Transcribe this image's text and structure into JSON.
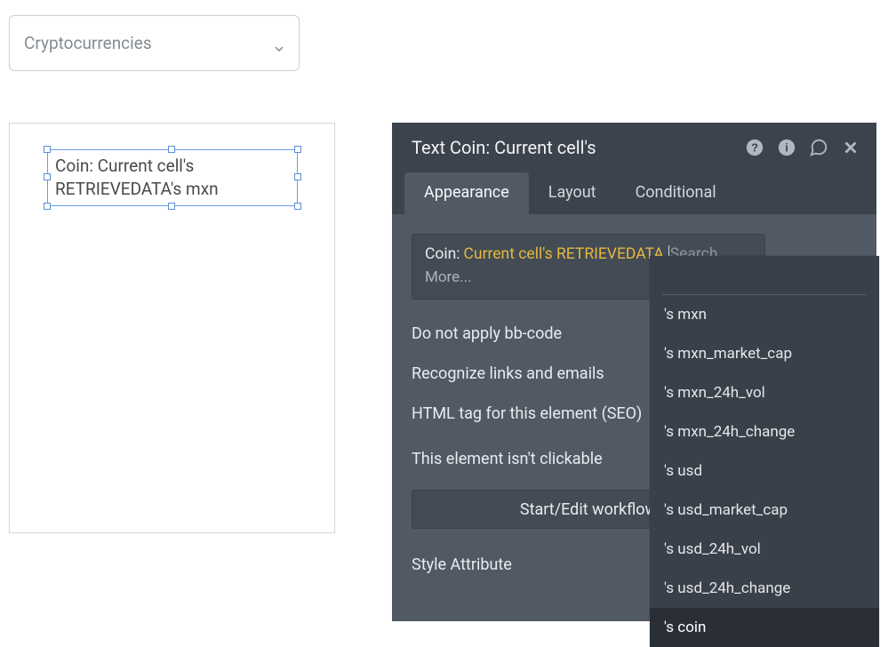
{
  "dropdown": {
    "value": "Cryptocurrencies"
  },
  "canvas": {
    "selected_text": "Coin: Current cell's RETRIEVEDATA's mxn"
  },
  "panel": {
    "title": "Text Coin: Current cell's",
    "tabs": {
      "appearance": "Appearance",
      "layout": "Layout",
      "conditional": "Conditional"
    },
    "expression": {
      "static": "Coin:",
      "dynamic": "Current cell's RETRIEVEDATA",
      "search_placeholder": "Search...",
      "more": "More..."
    },
    "options": {
      "bbcode": "Do not apply bb-code",
      "recognize": "Recognize links and emails",
      "html_tag": "HTML tag for this element (SEO)",
      "not_clickable": "This element isn't clickable",
      "workflow_btn": "Start/Edit workflow",
      "style_attr": "Style Attribute"
    }
  },
  "autocomplete": {
    "items": [
      "'s mxn",
      "'s mxn_market_cap",
      "'s mxn_24h_vol",
      "'s mxn_24h_change",
      "'s usd",
      "'s usd_market_cap",
      "'s usd_24h_vol",
      "'s usd_24h_change",
      "'s coin"
    ],
    "hovered_index": 8
  }
}
